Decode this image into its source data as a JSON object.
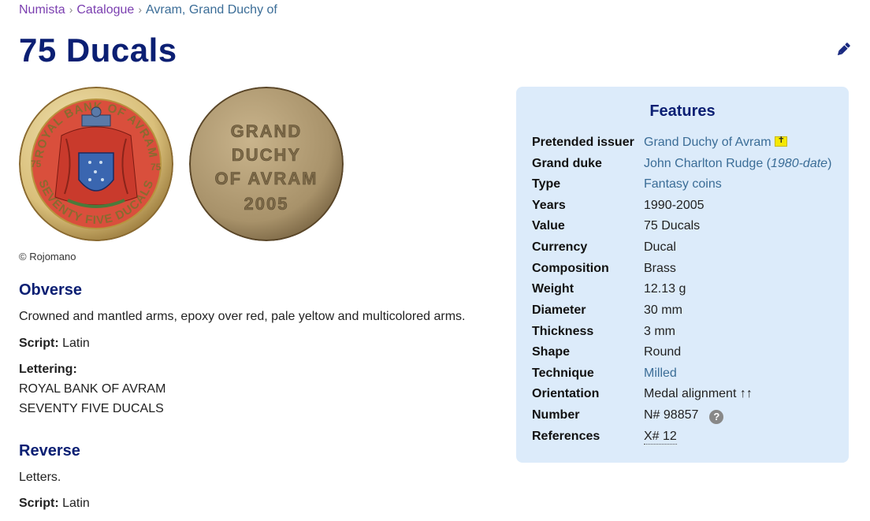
{
  "breadcrumb": {
    "items": [
      "Numista",
      "Catalogue",
      "Avram, Grand Duchy of"
    ],
    "separator": "›"
  },
  "page": {
    "title": "75 Ducals"
  },
  "images": {
    "credit": "© Rojomano",
    "obverse_legend_top": "ROYAL BANK OF AVRAM",
    "obverse_legend_bottom": "SEVENTY FIVE DUCALS",
    "obverse_left_value": "75",
    "obverse_right_value": "75",
    "reverse_lines": [
      "GRAND",
      "DUCHY",
      "OF AVRAM",
      "2005"
    ]
  },
  "obverse": {
    "heading": "Obverse",
    "description": "Crowned and mantled arms, epoxy over red, pale yeltow and multicolored arms.",
    "script_label": "Script:",
    "script_value": "Latin",
    "lettering_label": "Lettering:",
    "lettering_lines": [
      "ROYAL BANK OF AVRAM",
      "SEVENTY FIVE DUCALS"
    ]
  },
  "reverse": {
    "heading": "Reverse",
    "description": "Letters.",
    "script_label": "Script:",
    "script_value": "Latin"
  },
  "features": {
    "heading": "Features",
    "rows": [
      {
        "label": "Pretended issuer",
        "value": "Grand Duchy of Avram"
      },
      {
        "label": "Grand duke",
        "value": "John Charlton Rudge",
        "value_extra": "1980-date"
      },
      {
        "label": "Type",
        "value": "Fantasy coins"
      },
      {
        "label": "Years",
        "value": "1990-2005"
      },
      {
        "label": "Value",
        "value": "75 Ducals"
      },
      {
        "label": "Currency",
        "value": "Ducal"
      },
      {
        "label": "Composition",
        "value": "Brass"
      },
      {
        "label": "Weight",
        "value": "12.13 g"
      },
      {
        "label": "Diameter",
        "value": "30 mm"
      },
      {
        "label": "Thickness",
        "value": "3 mm"
      },
      {
        "label": "Shape",
        "value": "Round"
      },
      {
        "label": "Technique",
        "value": "Milled"
      },
      {
        "label": "Orientation",
        "value": "Medal alignment ↑↑"
      },
      {
        "label": "Number",
        "value": "N# 98857"
      },
      {
        "label": "References",
        "value": "X# 12"
      }
    ],
    "help_icon_glyph": "?"
  },
  "colors": {
    "title": "#0b1f73",
    "link": "#3b6d97",
    "breadcrumb_link": "#7b3fb0",
    "features_bg": "#dcebfa"
  }
}
